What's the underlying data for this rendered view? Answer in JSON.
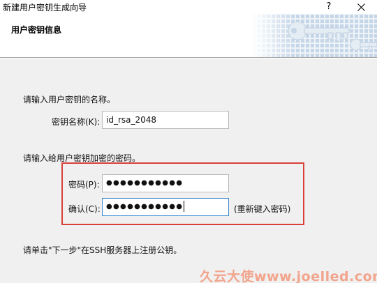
{
  "window": {
    "title": "新建用户密钥生成向导",
    "help_label": "?"
  },
  "header": {
    "title": "用户密钥信息"
  },
  "form": {
    "name_prompt": "请输入用户密钥的名称。",
    "key_name_label": "密钥名称(K):",
    "key_name_value": "id_rsa_2048",
    "passphrase_prompt": "请输入给用户密钥加密的密码。",
    "password_label": "密码(P):",
    "password_mask": "●●●●●●●●●●●",
    "confirm_label": "确认(C):",
    "confirm_mask": "●●●●●●●●●●●",
    "reenter_hint": "(重新键入密码)",
    "footer_note": "请单击\"下一步\"在SSH服务器上注册公钥。"
  },
  "watermark": "久云大使www.joelled.com",
  "colors": {
    "highlight_box": "#d9403a",
    "focus_border": "#3f88d4",
    "watermark": "#f2a48c"
  },
  "icons": [
    "close-icon",
    "key-icon"
  ]
}
